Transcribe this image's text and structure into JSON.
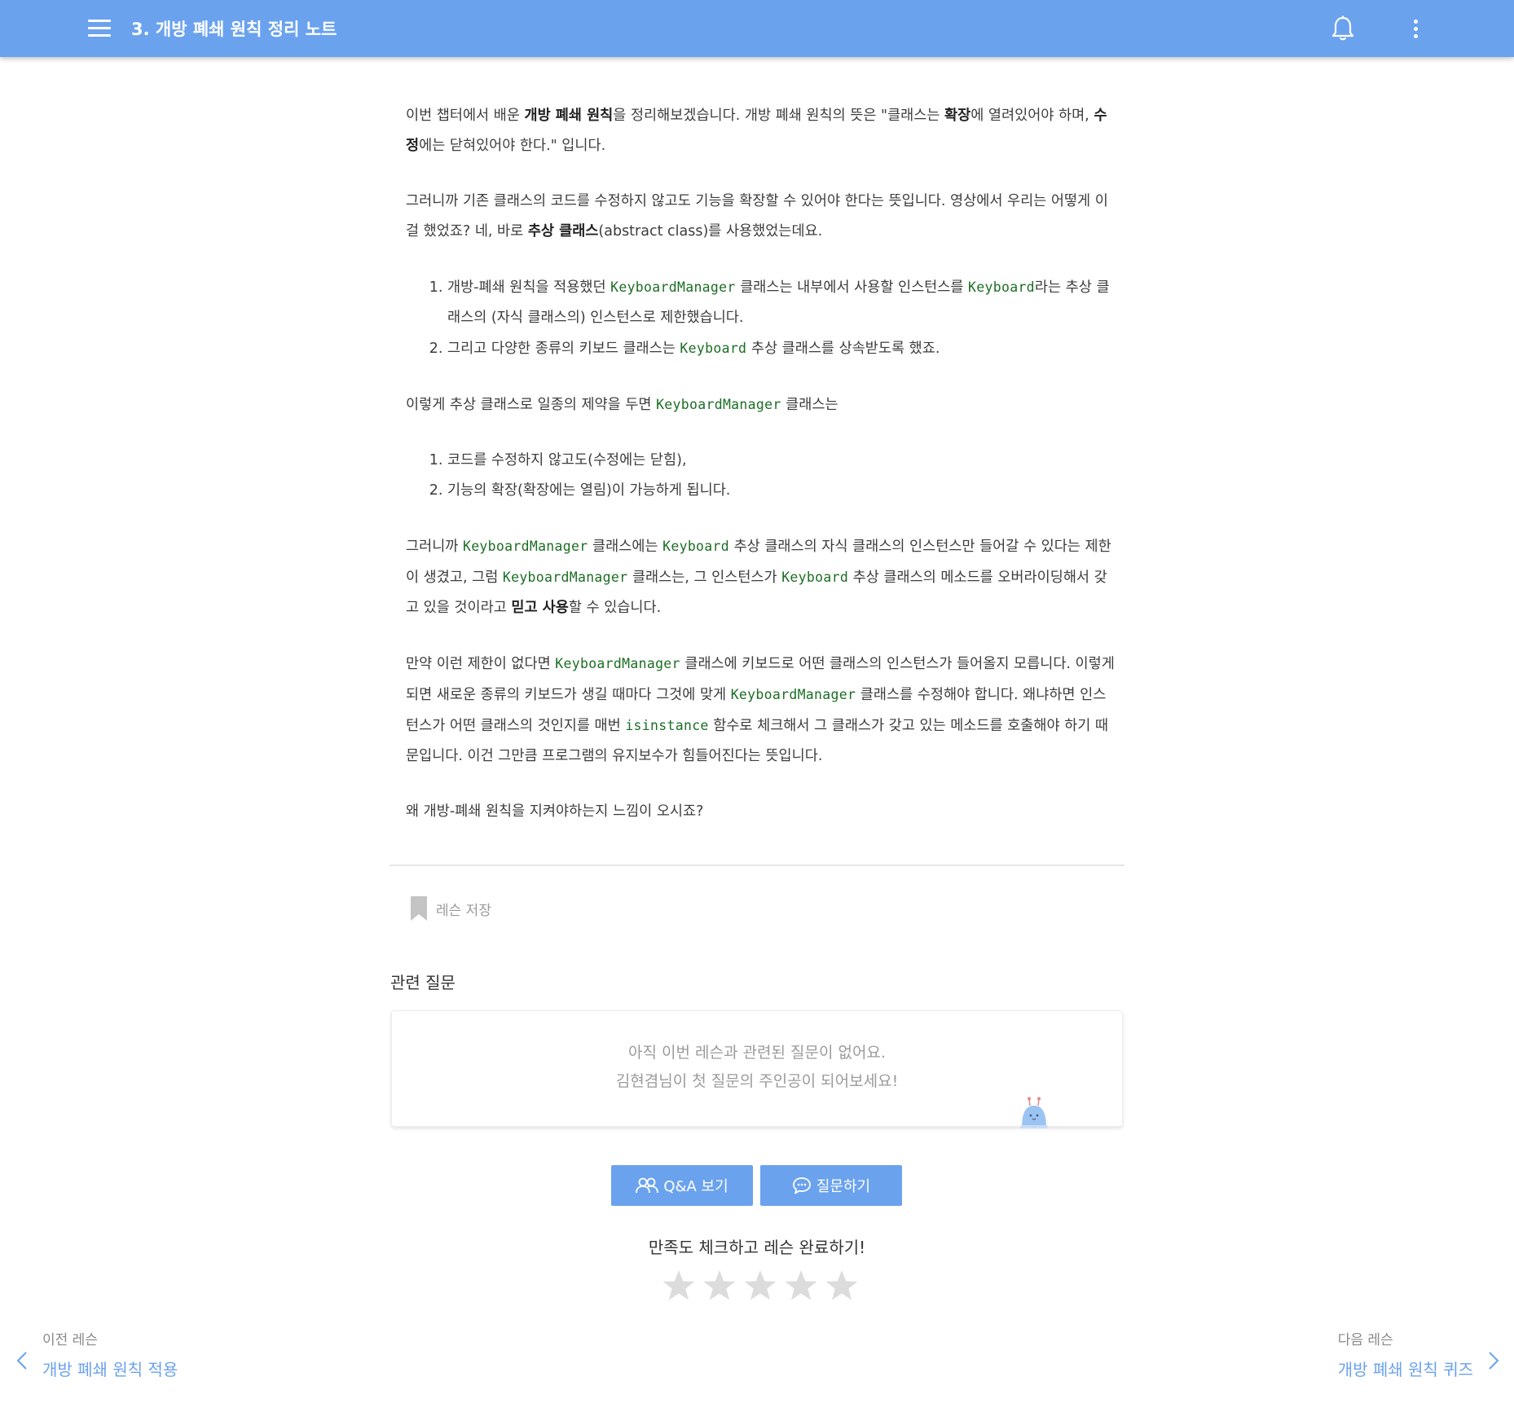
{
  "header": {
    "title": "3. 개방 폐쇄 원칙 정리 노트",
    "menu_icon": "hamburger-menu-icon",
    "bell_icon": "bell-icon",
    "more_icon": "more-vertical-icon"
  },
  "lesson": {
    "p1": {
      "a": "이번 챕터에서 배운 ",
      "b": "개방 폐쇄 원칙",
      "c": "을 정리해보겠습니다. 개방 폐쇄 원칙의 뜻은 \"클래스는 ",
      "d": "확장",
      "e": "에 열려있어야 하며, ",
      "f": "수정",
      "g": "에는 닫혀있어야 한다.\" 입니다."
    },
    "p2": {
      "a": "그러니까 기존 클래스의 코드를 수정하지 않고도 기능을 확장할 수 있어야 한다는 뜻입니다. 영상에서 우리는 어떻게 이걸 했었죠? 네, 바로 ",
      "b": "추상 클래스",
      "c": "(abstract class)를 사용했었는데요."
    },
    "list1": {
      "item1": {
        "a": "개방-폐쇄 원칙을 적용했던 ",
        "code1": "KeyboardManager",
        "b": " 클래스는 내부에서 사용할 인스턴스를 ",
        "code2": "Keyboard",
        "c": "라는 추상 클래스의 (자식 클래스의) 인스턴스로 제한했습니다."
      },
      "item2": {
        "a": "그리고 다양한 종류의 키보드 클래스는 ",
        "code1": "Keyboard",
        "b": " 추상 클래스를 상속받도록 했죠."
      }
    },
    "p3": {
      "a": "이렇게 추상 클래스로 일종의 제약을 두면 ",
      "code1": "KeyboardManager",
      "b": " 클래스는"
    },
    "list2": {
      "item1": "코드를 수정하지 않고도(수정에는 닫힘),",
      "item2": "기능의 확장(확장에는 열림)이 가능하게 됩니다."
    },
    "p4": {
      "a": "그러니까 ",
      "code1": "KeyboardManager",
      "b": " 클래스에는 ",
      "code2": "Keyboard",
      "c": " 추상 클래스의 자식 클래스의 인스턴스만 들어갈 수 있다는 제한이 생겼고, 그럼 ",
      "code3": "KeyboardManager",
      "d": " 클래스는, 그 인스턴스가 ",
      "code4": "Keyboard",
      "e": " 추상 클래스의 메소드를 오버라이딩해서 갖고 있을 것이라고 ",
      "f": "믿고 사용",
      "g": "할 수 있습니다."
    },
    "p5": {
      "a": "만약 이런 제한이 없다면 ",
      "code1": "KeyboardManager",
      "b": " 클래스에 키보드로 어떤 클래스의 인스턴스가 들어올지 모릅니다. 이렇게 되면 새로운 종류의 키보드가 생길 때마다 그것에 맞게 ",
      "code2": "KeyboardManager",
      "c": " 클래스를 수정해야 합니다. 왜냐하면 인스턴스가 어떤 클래스의 것인지를 매번 ",
      "code3": "isinstance",
      "d": " 함수로 체크해서 그 클래스가 갖고 있는 메소드를 호출해야 하기 때문입니다. 이건 그만큼 프로그램의 유지보수가 힘들어진다는 뜻입니다."
    },
    "p6": "왜 개방-폐쇄 원칙을 지켜야하는지 느낌이 오시죠?"
  },
  "save": {
    "label": "레슨 저장",
    "icon": "bookmark-icon"
  },
  "related_questions": {
    "title": "관련 질문",
    "empty_line1": "아직 이번 레슨과 관련된 질문이 없어요.",
    "empty_line2": "김현겸님이 첫 질문의 주인공이 되어보세요!",
    "mascot_icon": "mascot-icon"
  },
  "buttons": {
    "qa_label": "Q&A 보기",
    "qa_icon": "users-icon",
    "ask_label": "질문하기",
    "ask_icon": "chat-bubble-icon"
  },
  "rating": {
    "label": "만족도 체크하고 레슨 완료하기!",
    "max": 5,
    "value": 0
  },
  "navigation": {
    "prev_small": "이전 레슨",
    "prev_title": "개방 폐쇄 원칙 적용",
    "next_small": "다음 레슨",
    "next_title": "개방 폐쇄 원칙 퀴즈"
  },
  "colors": {
    "header": "#6aa2ee",
    "accent": "#6aa2ee",
    "code": "#1c6e24",
    "star_empty": "#dcdcdc"
  }
}
